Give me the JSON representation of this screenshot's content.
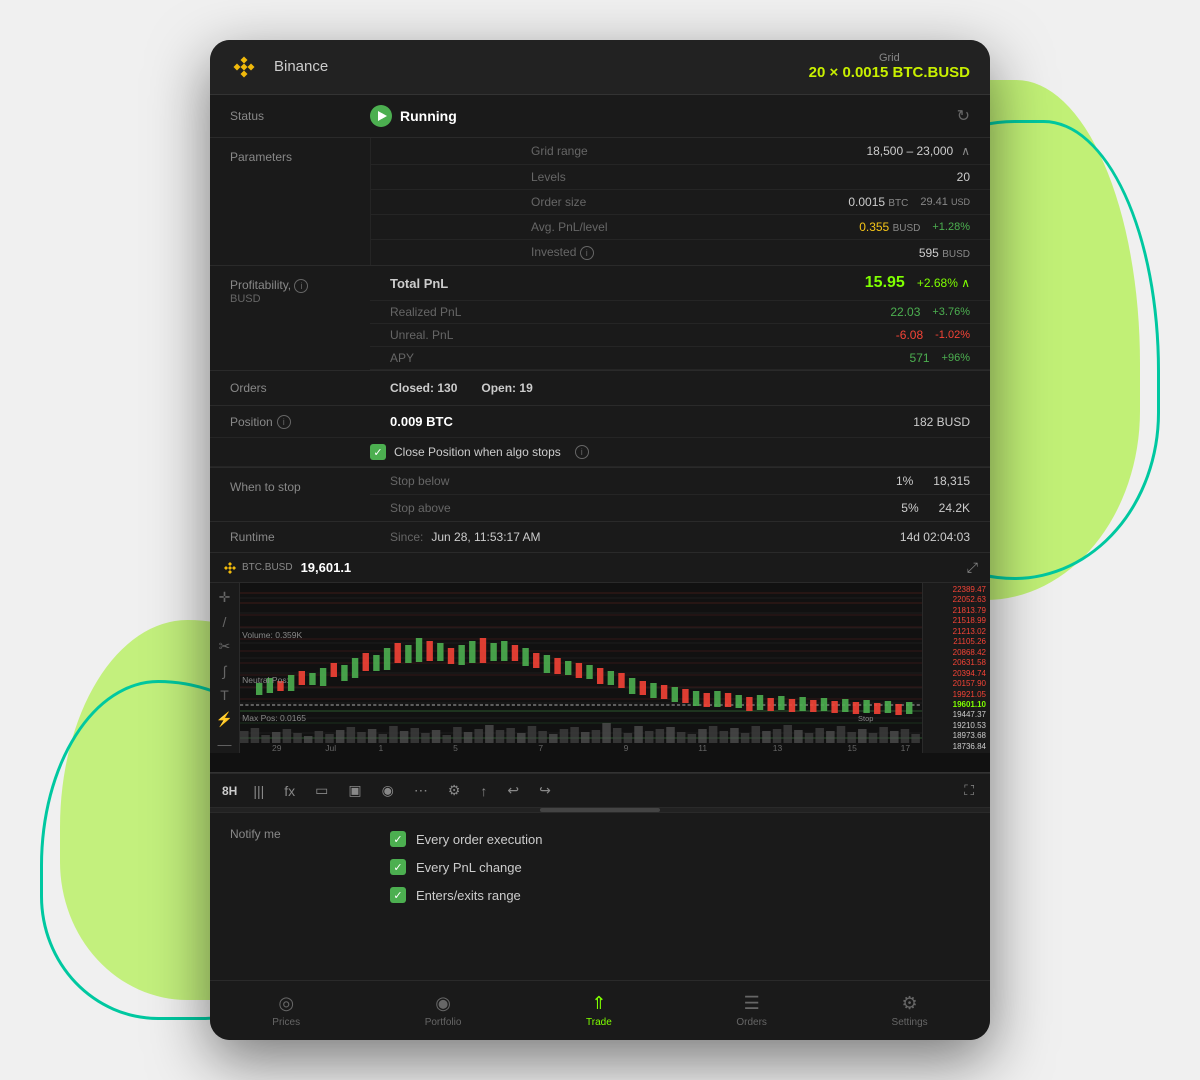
{
  "app": {
    "title": "Binance",
    "grid_label": "Grid",
    "grid_subtitle": "20 × 0.0015 BTC.BUSD"
  },
  "status": {
    "label": "Status",
    "value": "Running",
    "refresh_icon": "↻"
  },
  "parameters": {
    "label": "Parameters",
    "grid_range_label": "Grid range",
    "grid_range_value": "18,500 – 23,000",
    "levels_label": "Levels",
    "levels_value": "20",
    "order_size_label": "Order size",
    "order_size_value": "0.0015",
    "order_size_unit": "BTC",
    "order_size_usd": "29.41",
    "order_size_usd_unit": "USD",
    "avg_pnl_label": "Avg. PnL/level",
    "avg_pnl_value": "0.355",
    "avg_pnl_unit": "BUSD",
    "avg_pnl_pct": "+1.28%",
    "invested_label": "Invested",
    "invested_value": "595",
    "invested_unit": "BUSD"
  },
  "profitability": {
    "label": "Profitability,",
    "sublabel": "BUSD",
    "total_pnl_label": "Total PnL",
    "total_pnl_value": "15.95",
    "total_pnl_pct": "+2.68%",
    "realized_label": "Realized PnL",
    "realized_value": "22.03",
    "realized_pct": "+3.76%",
    "unreal_label": "Unreal. PnL",
    "unreal_value": "-6.08",
    "unreal_pct": "-1.02%",
    "apy_label": "APY",
    "apy_value": "571",
    "apy_pct": "+96%"
  },
  "orders": {
    "label": "Orders",
    "closed_label": "Closed:",
    "closed_value": "130",
    "open_label": "Open:",
    "open_value": "19"
  },
  "position": {
    "label": "Position",
    "btc_value": "0.009 BTC",
    "busd_value": "182 BUSD",
    "close_position_label": "Close Position when algo stops"
  },
  "when_to_stop": {
    "label": "When to stop",
    "stop_below_label": "Stop below",
    "stop_below_pct": "1%",
    "stop_below_value": "18,315",
    "stop_above_label": "Stop above",
    "stop_above_pct": "5%",
    "stop_above_value": "24.2K"
  },
  "runtime": {
    "label": "Runtime",
    "since_label": "Since:",
    "since_value": "Jun 28, 11:53:17 AM",
    "duration": "14d 02:04:03"
  },
  "chart": {
    "pair": "BTC.BUSD",
    "price": "19,601.1",
    "timeframe": "8H",
    "expand_icon": "⤢",
    "price_levels": [
      "22389.47",
      "22052.63",
      "21813.79",
      "21518.99",
      "21213.02",
      "21105.26",
      "20868.42",
      "20631.58",
      "20394.74",
      "20157.90",
      "19921.05",
      "19601.10",
      "19447.37",
      "19210.53",
      "18973.68",
      "18736.84"
    ]
  },
  "chart_toolbar": {
    "timeframe": "8H",
    "icons": [
      "|||",
      "fx",
      "▭",
      "▣",
      "◉",
      "⋯",
      "⚙",
      "↑",
      "↩",
      "↪",
      "⛶"
    ]
  },
  "notify": {
    "label": "Notify me",
    "items": [
      {
        "text": "Every order execution",
        "checked": true
      },
      {
        "text": "Every PnL change",
        "checked": true
      },
      {
        "text": "Enters/exits range",
        "checked": true
      }
    ]
  },
  "bottom_nav": {
    "items": [
      {
        "label": "Prices",
        "icon": "◎",
        "active": false
      },
      {
        "label": "Portfolio",
        "icon": "◉",
        "active": false
      },
      {
        "label": "Trade",
        "icon": "⇑",
        "active": true
      },
      {
        "label": "Orders",
        "icon": "☰",
        "active": false
      },
      {
        "label": "Settings",
        "icon": "⚙",
        "active": false
      }
    ]
  }
}
